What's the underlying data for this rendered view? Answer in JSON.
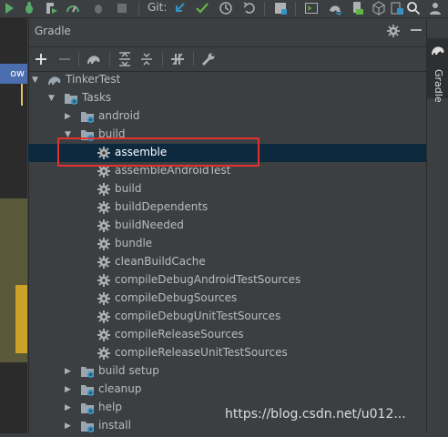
{
  "toolbar": {
    "git_label": "Git:"
  },
  "left_strip": {
    "tab_label": "ow"
  },
  "panel": {
    "title": "Gradle"
  },
  "right_strip": {
    "tab_label": "Gradle"
  },
  "tree": {
    "root": "TinkerTest",
    "tasks": "Tasks",
    "android": "android",
    "build": "build",
    "build_items": [
      "assemble",
      "assembleAndroidTest",
      "build",
      "buildDependents",
      "buildNeeded",
      "bundle",
      "cleanBuildCache",
      "compileDebugAndroidTestSources",
      "compileDebugSources",
      "compileDebugUnitTestSources",
      "compileReleaseSources",
      "compileReleaseUnitTestSources"
    ],
    "build_setup": "build setup",
    "cleanup": "cleanup",
    "help": "help",
    "install": "install"
  },
  "watermark": "https://blog.csdn.net/u012...",
  "colors": {
    "accent": "#4b6eaf",
    "selection": "#0d293e",
    "highlight_box": "#e0332f",
    "success": "#62b543"
  }
}
